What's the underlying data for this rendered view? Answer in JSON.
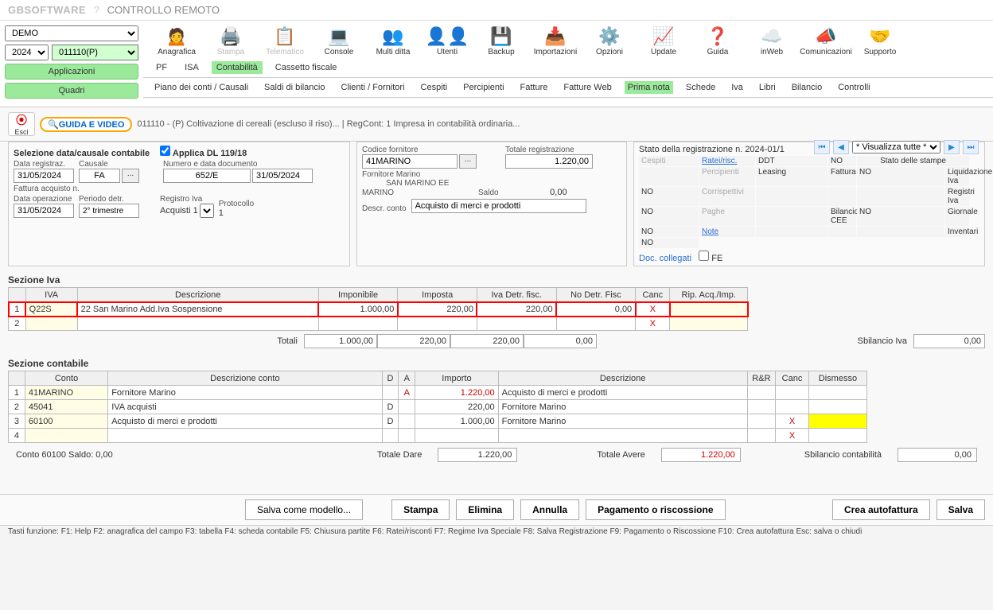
{
  "titlebar": {
    "brand": "GBSOFTWARE",
    "q": "?",
    "remote": "CONTROLLO REMOTO"
  },
  "topLeft": {
    "company": "DEMO",
    "year": "2024",
    "code": "011110(P)",
    "applicazioni": "Applicazioni",
    "quadri": "Quadri"
  },
  "ribbon": [
    {
      "label": "Anagrafica",
      "icon": "🙍"
    },
    {
      "label": "Stampa",
      "icon": "🖨️",
      "disabled": true
    },
    {
      "label": "Telematico",
      "icon": "📋",
      "disabled": true
    },
    {
      "label": "Console",
      "icon": "💻"
    },
    {
      "label": "Multi ditta",
      "icon": "👥"
    },
    {
      "label": "Utenti",
      "icon": "👤👤"
    },
    {
      "label": "Backup",
      "icon": "💾"
    },
    {
      "label": "Importazioni",
      "icon": "📥"
    },
    {
      "label": "Opzioni",
      "icon": "⚙️"
    },
    {
      "label": "Update",
      "icon": "📈"
    },
    {
      "label": "Guida",
      "icon": "❓"
    },
    {
      "label": "inWeb",
      "icon": "☁️"
    },
    {
      "label": "Comunicazioni",
      "icon": "📣"
    },
    {
      "label": "Supporto",
      "icon": "🤝"
    }
  ],
  "tabs1": [
    "PF",
    "ISA",
    "Contabilità",
    "Cassetto fiscale"
  ],
  "tabs1_active": "Contabilità",
  "subtabs": [
    "Piano dei conti / Causali",
    "Saldi di bilancio",
    "Clienti / Fornitori",
    "Cespiti",
    "Percipienti",
    "Fatture",
    "Fatture Web",
    "Prima nota",
    "Schede",
    "Iva",
    "Libri",
    "Bilancio",
    "Controlli"
  ],
  "subtabs_active": "Prima nota",
  "esci": {
    "label": "Esci",
    "glyph": "⦿"
  },
  "guidaVideo": "🔍GUIDA E VIDEO",
  "docInfo": "011110 - (P) Coltivazione di cereali (escluso il riso)... | RegCont: 1 Impresa  in contabilità ordinaria...",
  "navSelect": "* Visualizza tutte *",
  "selCausale": {
    "title": "Selezione data/causale contabile",
    "applicaDL": "Applica DL 119/18",
    "dataRegLbl": "Data registraz.",
    "dataReg": "31/05/2024",
    "causaleLbl": "Causale",
    "causale": "FA",
    "numDocLbl": "Numero e data documento",
    "numDoc": "652/E",
    "dataDoc": "31/05/2024",
    "fattAcqLbl": "Fattura acquisto n.",
    "dataOpLbl": "Data operazione",
    "dataOp": "31/05/2024",
    "periodoDetrLbl": "Periodo detr.",
    "periodoDetr": "2° trimestre",
    "registroIvaLbl": "Registro Iva",
    "registroIva": "Acquisti 1",
    "protocolloLbl": "Protocollo",
    "protocollo": "1"
  },
  "fornitore": {
    "codLbl": "Codice fornitore",
    "cod": "41MARINO",
    "name": "Fornitore Marino",
    "name2": "SAN MARINO EE",
    "name3": "MARINO",
    "saldoLbl": "Saldo",
    "saldo": "0,00",
    "descrContoLbl": "Descr. conto",
    "descrConto": "Acquisto di merci e prodotti",
    "totRegLbl": "Totale registrazione",
    "totReg": "1.220,00"
  },
  "stato": {
    "header": "Stato della registrazione n. 2024-01/1",
    "rows": [
      [
        "Cespiti",
        "Ratei/risc.",
        "DDT",
        "NO",
        "Stato delle stampe",
        ""
      ],
      [
        "Percipienti",
        "Leasing",
        "Fattura",
        "NO",
        "Liquidazione Iva",
        "NO"
      ],
      [
        "Corrispettivi",
        "",
        "",
        "",
        "Registri Iva",
        "NO"
      ],
      [
        "Paghe",
        "",
        "Bilancio CEE",
        "NO",
        "Giornale",
        "NO"
      ],
      [
        "Note",
        "",
        "",
        "",
        "Inventari",
        "NO"
      ]
    ],
    "docCollegati": "Doc. collegati",
    "fe": "FE"
  },
  "sezIva": {
    "title": "Sezione Iva",
    "cols": [
      "",
      "IVA",
      "Descrizione",
      "Imponibile",
      "Imposta",
      "Iva Detr. fisc.",
      "No Detr. Fisc",
      "Canc",
      "Rip. Acq./Imp."
    ],
    "rows": [
      {
        "n": "1",
        "iva": "Q22S",
        "descr": "22 San Marino Add.Iva Sospensione",
        "imp": "1.000,00",
        "imposta": "220,00",
        "detr": "220,00",
        "nodetr": "0,00",
        "canc": "X",
        "highlight": true
      },
      {
        "n": "2",
        "iva": "",
        "descr": "",
        "imp": "",
        "imposta": "",
        "detr": "",
        "nodetr": "",
        "canc": "X"
      }
    ],
    "totali": "Totali",
    "t_imp": "1.000,00",
    "t_imposta": "220,00",
    "t_detr": "220,00",
    "t_nodetr": "0,00",
    "sbilIva": "Sbilancio Iva",
    "sbilIvaVal": "0,00"
  },
  "sezCont": {
    "title": "Sezione contabile",
    "cols": [
      "",
      "Conto",
      "Descrizione conto",
      "D",
      "A",
      "Importo",
      "Descrizione",
      "R&R",
      "Canc",
      "Dismesso"
    ],
    "rows": [
      {
        "n": "1",
        "conto": "41MARINO",
        "dc": "Fornitore Marino",
        "d": "",
        "a": "A",
        "imp": "1.220,00",
        "desc": "Acquisto di merci e prodotti",
        "red": true
      },
      {
        "n": "2",
        "conto": "45041",
        "dc": "IVA acquisti",
        "d": "D",
        "a": "",
        "imp": "220,00",
        "desc": "Fornitore Marino"
      },
      {
        "n": "3",
        "conto": "60100",
        "dc": "Acquisto di merci e prodotti",
        "d": "D",
        "a": "",
        "imp": "1.000,00",
        "desc": "Fornitore Marino",
        "canc": "X",
        "yellow": true
      },
      {
        "n": "4",
        "conto": "",
        "dc": "",
        "d": "",
        "a": "",
        "imp": "",
        "desc": "",
        "canc": "X"
      }
    ],
    "saldoLbl": "Conto 60100 Saldo: 0,00",
    "totDareLbl": "Totale Dare",
    "totDare": "1.220,00",
    "totAvereLbl": "Totale Avere",
    "totAvere": "1.220,00",
    "sbilLbl": "Sbilancio contabilità",
    "sbilVal": "0,00"
  },
  "footer": {
    "salvaModello": "Salva come modello...",
    "stampa": "Stampa",
    "elimina": "Elimina",
    "annulla": "Annulla",
    "pagRisc": "Pagamento o riscossione",
    "creaAutofatt": "Crea autofattura",
    "salva": "Salva"
  },
  "fnkeys": "Tasti funzione:  F1: Help  F2: anagrafica del campo  F3: tabella  F4: scheda contabile F5: Chiusura partite  F6: Ratei/risconti  F7: Regime Iva Speciale F8: Salva Registrazione  F9: Pagamento o Riscossione F10: Crea autofattura  Esc: salva o chiudi"
}
